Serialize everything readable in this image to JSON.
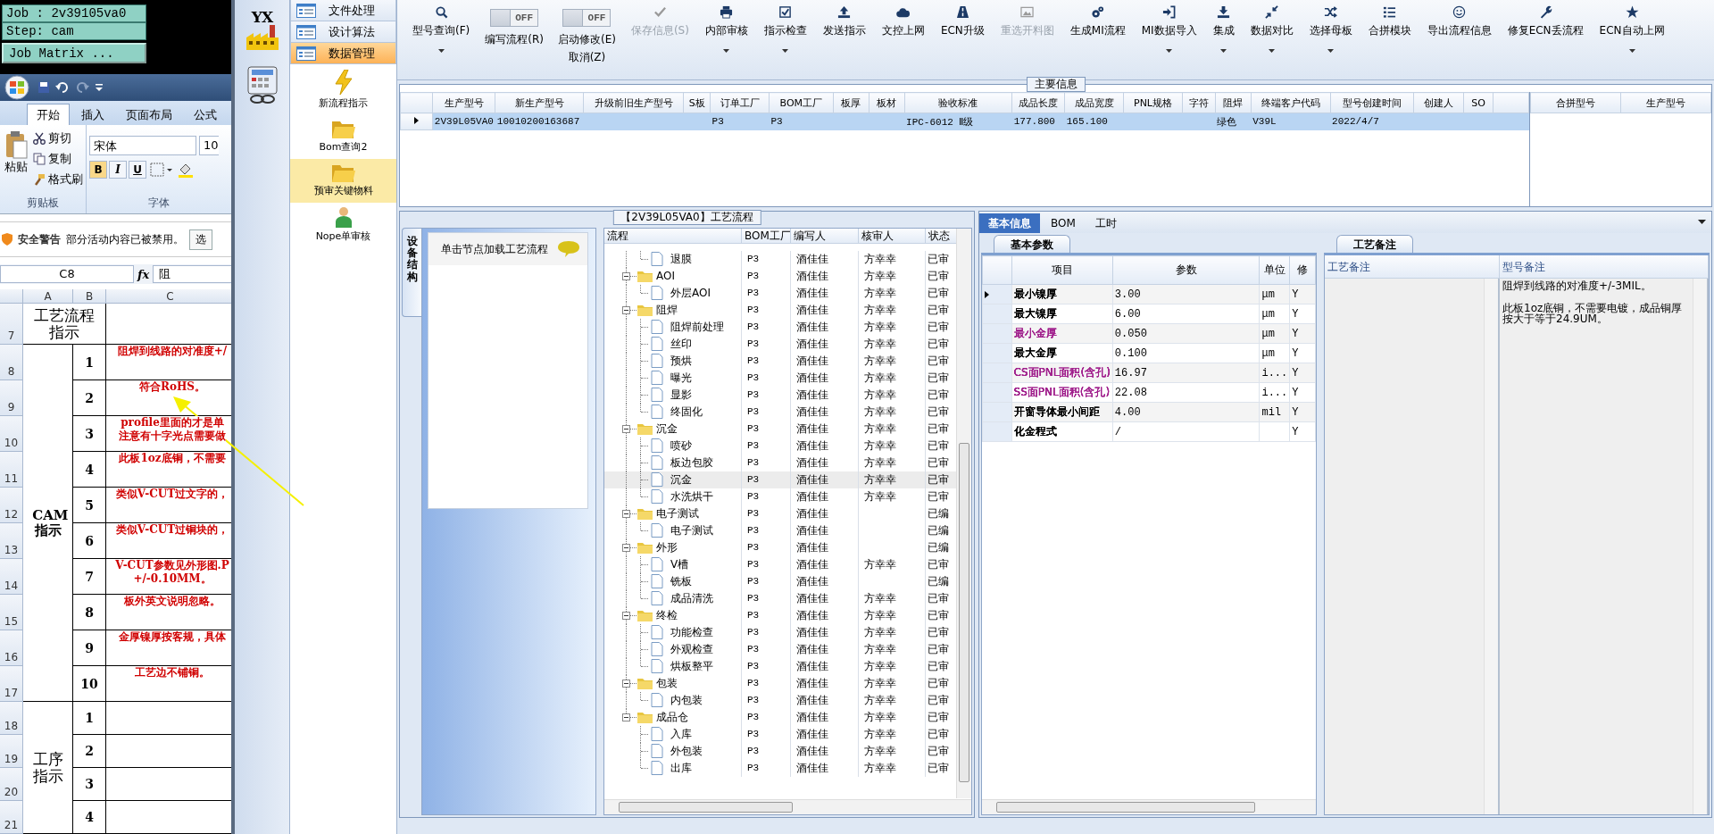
{
  "job_box": {
    "job": "Job : 2v39105va0",
    "step": "Step: cam",
    "button": "Job Matrix ..."
  },
  "excel": {
    "ribbon_tabs": [
      {
        "label": "开始",
        "selected": true
      },
      {
        "label": "插入",
        "selected": false
      },
      {
        "label": "页面布局",
        "selected": false
      },
      {
        "label": "公式",
        "selected": false
      }
    ],
    "clipboard": {
      "paste": "粘贴",
      "cut": "剪切",
      "copy": "复制",
      "format_painter": "格式刷",
      "group": "剪贴板"
    },
    "font": {
      "name": "宋体",
      "size": "10",
      "bold": "B",
      "italic": "I",
      "underline": "U",
      "group": "字体"
    },
    "security": {
      "title": "安全警告",
      "message": "部分活动内容已被禁用。",
      "button": "选"
    },
    "name_box": "C8",
    "fx": "fx",
    "formula": "阻",
    "columns": [
      "A",
      "B",
      "C"
    ],
    "sections": [
      {
        "kind": "header",
        "title": "工艺流程指示",
        "items": [
          {
            "row": "7"
          }
        ]
      },
      {
        "kind": "group",
        "title": "CAM指示",
        "items": [
          {
            "row": "8",
            "number": "1",
            "lines": [
              "阻焊到线路的对准度+/"
            ]
          },
          {
            "row": "9",
            "number": "2",
            "lines": [
              "符合RoHS。"
            ]
          },
          {
            "row": "10",
            "number": "3",
            "lines": [
              "profile里面的才是单",
              "注意有十字光点需要做"
            ]
          },
          {
            "row": "11",
            "number": "4",
            "lines": [
              "此板1oz底铜，不需要"
            ]
          },
          {
            "row": "12",
            "number": "5",
            "lines": [
              "类似V-CUT过文字的，"
            ]
          },
          {
            "row": "13",
            "number": "6",
            "lines": [
              "类似V-CUT过铜块的，"
            ]
          },
          {
            "row": "14",
            "number": "7",
            "lines": [
              "V-CUT参数见外形图.P",
              "+/-0.10MM。"
            ]
          },
          {
            "row": "15",
            "number": "8",
            "lines": [
              "板外英文说明忽略。"
            ]
          },
          {
            "row": "16",
            "number": "9",
            "lines": [
              "金厚镍厚按客规，具体"
            ]
          },
          {
            "row": "17",
            "number": "10",
            "lines": [
              "工艺边不铺铜。"
            ]
          }
        ]
      },
      {
        "kind": "group",
        "title": "工序指示",
        "items": [
          {
            "row": "18",
            "number": "1"
          },
          {
            "row": "19",
            "number": "2"
          },
          {
            "row": "20",
            "number": "3"
          },
          {
            "row": "21",
            "number": "4"
          }
        ]
      }
    ]
  },
  "app_logo": "YX",
  "nav": {
    "modules": [
      {
        "label": "文件处理",
        "selected": false
      },
      {
        "label": "设计算法",
        "selected": false
      },
      {
        "label": "数据管理",
        "selected": true
      }
    ],
    "items": [
      {
        "label": "新流程指示",
        "selected": false
      },
      {
        "label": "Bom查询2",
        "selected": false
      },
      {
        "label": "预审关键物料",
        "selected": true
      },
      {
        "label": "Nope单审核",
        "selected": false
      }
    ]
  },
  "toolbar": [
    {
      "kind": "button",
      "label": "型号查询(F)",
      "dropdown": true,
      "disabled": false
    },
    {
      "kind": "toggle",
      "label": "编写流程(R)",
      "state_text": "OFF",
      "on": false
    },
    {
      "kind": "toggle",
      "label": "启动修改(E)",
      "sublabel": "取消(Z)",
      "state_text": "OFF",
      "on": false
    },
    {
      "kind": "button",
      "label": "保存信息(S)",
      "dropdown": false,
      "disabled": true
    },
    {
      "kind": "button",
      "label": "内部审核",
      "dropdown": true,
      "disabled": false
    },
    {
      "kind": "button",
      "label": "指示检查",
      "dropdown": true,
      "disabled": false
    },
    {
      "kind": "button",
      "label": "发送指示",
      "dropdown": false,
      "disabled": false
    },
    {
      "kind": "button",
      "label": "文控上网",
      "dropdown": false,
      "disabled": false
    },
    {
      "kind": "button",
      "label": "ECN升级",
      "dropdown": false,
      "disabled": false
    },
    {
      "kind": "button",
      "label": "重选开料图",
      "dropdown": false,
      "disabled": true
    },
    {
      "kind": "button",
      "label": "生成MI流程",
      "dropdown": false,
      "disabled": false
    },
    {
      "kind": "button",
      "label": "MI数据导入",
      "dropdown": true,
      "disabled": false
    },
    {
      "kind": "button",
      "label": "集成",
      "dropdown": true,
      "disabled": false
    },
    {
      "kind": "button",
      "label": "数据对比",
      "dropdown": true,
      "disabled": false
    },
    {
      "kind": "button",
      "label": "选择母板",
      "dropdown": true,
      "disabled": false
    },
    {
      "kind": "button",
      "label": "合拼模块",
      "dropdown": false,
      "disabled": false
    },
    {
      "kind": "button",
      "label": "导出流程信息",
      "dropdown": false,
      "disabled": false
    },
    {
      "kind": "button",
      "label": "修复ECN丢流程",
      "dropdown": false,
      "disabled": false
    },
    {
      "kind": "button",
      "label": "ECN自动上网",
      "dropdown": true,
      "disabled": false
    }
  ],
  "main_info": {
    "title": "主要信息",
    "columns": [
      "生产型号",
      "新生产型号",
      "升级前旧生产型号",
      "S板",
      "订单工厂",
      "BOM工厂",
      "板厚",
      "板材",
      "验收标准",
      "成品长度",
      "成品宽度",
      "PNL规格",
      "字符",
      "阻焊",
      "终端客户代码",
      "型号创建时间",
      "创建人",
      "SO"
    ],
    "rows": [
      {
        "selected": true,
        "cells": [
          "2V39L05VA0",
          "10010200163687",
          null,
          null,
          "P3",
          "P3",
          null,
          null,
          "IPC-6012 Ⅱ级",
          "177.800",
          "165.100",
          null,
          null,
          "绿色",
          "V39L",
          "2022/4/7",
          null,
          null
        ]
      }
    ],
    "merge_columns": [
      "合拼型号",
      "生产型号"
    ]
  },
  "flow": {
    "title": "【2V39L05VA0】工艺流程",
    "side_tab": "设备结构",
    "hint": "单击节点加载工艺流程",
    "columns": [
      "流程",
      "BOM工厂",
      "编写人",
      "核审人",
      "状态"
    ],
    "tree": [
      {
        "expanded": true,
        "children": [
          {
            "label": "退膜",
            "bom": "P3",
            "writer": "酒佳佳",
            "reviewer": "方幸幸",
            "status": "已审",
            "selected": false
          }
        ]
      },
      {
        "label": "AOI",
        "bom": "P3",
        "writer": "酒佳佳",
        "reviewer": "方幸幸",
        "status": "已审",
        "selected": false,
        "expanded": true,
        "children": [
          {
            "label": "外层AOI",
            "bom": "P3",
            "writer": "酒佳佳",
            "reviewer": "方幸幸",
            "status": "已审",
            "selected": false
          }
        ]
      },
      {
        "label": "阻焊",
        "bom": "P3",
        "writer": "酒佳佳",
        "reviewer": "方幸幸",
        "status": "已审",
        "selected": false,
        "expanded": true,
        "children": [
          {
            "label": "阻焊前处理",
            "bom": "P3",
            "writer": "酒佳佳",
            "reviewer": "方幸幸",
            "status": "已审",
            "selected": false
          },
          {
            "label": "丝印",
            "bom": "P3",
            "writer": "酒佳佳",
            "reviewer": "方幸幸",
            "status": "已审",
            "selected": false
          },
          {
            "label": "预烘",
            "bom": "P3",
            "writer": "酒佳佳",
            "reviewer": "方幸幸",
            "status": "已审",
            "selected": false
          },
          {
            "label": "曝光",
            "bom": "P3",
            "writer": "酒佳佳",
            "reviewer": "方幸幸",
            "status": "已审",
            "selected": false
          },
          {
            "label": "显影",
            "bom": "P3",
            "writer": "酒佳佳",
            "reviewer": "方幸幸",
            "status": "已审",
            "selected": false
          },
          {
            "label": "终固化",
            "bom": "P3",
            "writer": "酒佳佳",
            "reviewer": "方幸幸",
            "status": "已审",
            "selected": false
          }
        ]
      },
      {
        "label": "沉金",
        "bom": "P3",
        "writer": "酒佳佳",
        "reviewer": "方幸幸",
        "status": "已审",
        "selected": false,
        "expanded": true,
        "children": [
          {
            "label": "喷砂",
            "bom": "P3",
            "writer": "酒佳佳",
            "reviewer": "方幸幸",
            "status": "已审",
            "selected": false
          },
          {
            "label": "板边包胶",
            "bom": "P3",
            "writer": "酒佳佳",
            "reviewer": "方幸幸",
            "status": "已审",
            "selected": false
          },
          {
            "label": "沉金",
            "bom": "P3",
            "writer": "酒佳佳",
            "reviewer": "方幸幸",
            "status": "已审",
            "selected": true
          },
          {
            "label": "水洗烘干",
            "bom": "P3",
            "writer": "酒佳佳",
            "reviewer": "方幸幸",
            "status": "已审",
            "selected": false
          }
        ]
      },
      {
        "label": "电子测试",
        "bom": "P3",
        "writer": "酒佳佳",
        "status": "已编",
        "selected": false,
        "expanded": true,
        "children": [
          {
            "label": "电子测试",
            "bom": "P3",
            "writer": "酒佳佳",
            "status": "已编",
            "selected": false
          }
        ]
      },
      {
        "label": "外形",
        "bom": "P3",
        "writer": "酒佳佳",
        "status": "已编",
        "selected": false,
        "expanded": true,
        "children": [
          {
            "label": "V槽",
            "bom": "P3",
            "writer": "酒佳佳",
            "reviewer": "方幸幸",
            "status": "已审",
            "selected": false
          },
          {
            "label": "铣板",
            "bom": "P3",
            "writer": "酒佳佳",
            "status": "已编",
            "selected": false
          },
          {
            "label": "成品清洗",
            "bom": "P3",
            "writer": "酒佳佳",
            "reviewer": "方幸幸",
            "status": "已审",
            "selected": false
          }
        ]
      },
      {
        "label": "终检",
        "bom": "P3",
        "writer": "酒佳佳",
        "reviewer": "方幸幸",
        "status": "已审",
        "selected": false,
        "expanded": true,
        "children": [
          {
            "label": "功能检查",
            "bom": "P3",
            "writer": "酒佳佳",
            "reviewer": "方幸幸",
            "status": "已审",
            "selected": false
          },
          {
            "label": "外观检查",
            "bom": "P3",
            "writer": "酒佳佳",
            "reviewer": "方幸幸",
            "status": "已审",
            "selected": false
          },
          {
            "label": "烘板整平",
            "bom": "P3",
            "writer": "酒佳佳",
            "reviewer": "方幸幸",
            "status": "已审",
            "selected": false
          }
        ]
      },
      {
        "label": "包装",
        "bom": "P3",
        "writer": "酒佳佳",
        "reviewer": "方幸幸",
        "status": "已审",
        "selected": false,
        "expanded": true,
        "children": [
          {
            "label": "内包装",
            "bom": "P3",
            "writer": "酒佳佳",
            "reviewer": "方幸幸",
            "status": "已审",
            "selected": false
          }
        ]
      },
      {
        "label": "成品仓",
        "bom": "P3",
        "writer": "酒佳佳",
        "reviewer": "方幸幸",
        "status": "已审",
        "selected": false,
        "expanded": true,
        "children": [
          {
            "label": "入库",
            "bom": "P3",
            "writer": "酒佳佳",
            "reviewer": "方幸幸",
            "status": "已审",
            "selected": false
          },
          {
            "label": "外包装",
            "bom": "P3",
            "writer": "酒佳佳",
            "reviewer": "方幸幸",
            "status": "已审",
            "selected": false
          },
          {
            "label": "出库",
            "bom": "P3",
            "writer": "酒佳佳",
            "reviewer": "方幸幸",
            "status": "已审",
            "selected": false
          }
        ]
      }
    ]
  },
  "detail": {
    "tabs": [
      {
        "label": "基本信息",
        "selected": true
      },
      {
        "label": "BOM",
        "selected": false
      },
      {
        "label": "工时",
        "selected": false
      }
    ],
    "params": {
      "tab": "基本参数",
      "columns": [
        "项目",
        "参数",
        "单位",
        "修"
      ],
      "rows": [
        {
          "item": "最小镍厚",
          "value": "3.00",
          "unit": "μm",
          "flag": "Y",
          "color": "#000000",
          "selected": true
        },
        {
          "item": "最大镍厚",
          "value": "6.00",
          "unit": "μm",
          "flag": "Y",
          "color": "#000000",
          "selected": false
        },
        {
          "item": "最小金厚",
          "value": "0.050",
          "unit": "μm",
          "flag": "Y",
          "color": "#a0208c",
          "selected": false
        },
        {
          "item": "最大金厚",
          "value": "0.100",
          "unit": "μm",
          "flag": "Y",
          "color": "#000000",
          "selected": false
        },
        {
          "item": "CS面PNL面积(含孔)",
          "value": "16.97",
          "unit": "i...",
          "flag": "Y",
          "color": "#a0208c",
          "selected": false
        },
        {
          "item": "SS面PNL面积(含孔)",
          "value": "22.08",
          "unit": "i...",
          "flag": "Y",
          "color": "#a0208c",
          "selected": false
        },
        {
          "item": "开窗导体最小间距",
          "value": "4.00",
          "unit": "mil",
          "flag": "Y",
          "color": "#000000",
          "selected": false
        },
        {
          "item": "化金程式",
          "value": "/",
          "flag": "Y",
          "color": "#000000",
          "selected": false
        }
      ]
    },
    "notes": {
      "tab": "工艺备注",
      "columns": [
        "工艺备注",
        "型号备注"
      ],
      "model_notes": [
        "阻焊到线路的对准度+/-3MIL。",
        "此板1oz底铜，不需要电镀，成品铜厚按大于等于24.9UM。"
      ]
    }
  }
}
